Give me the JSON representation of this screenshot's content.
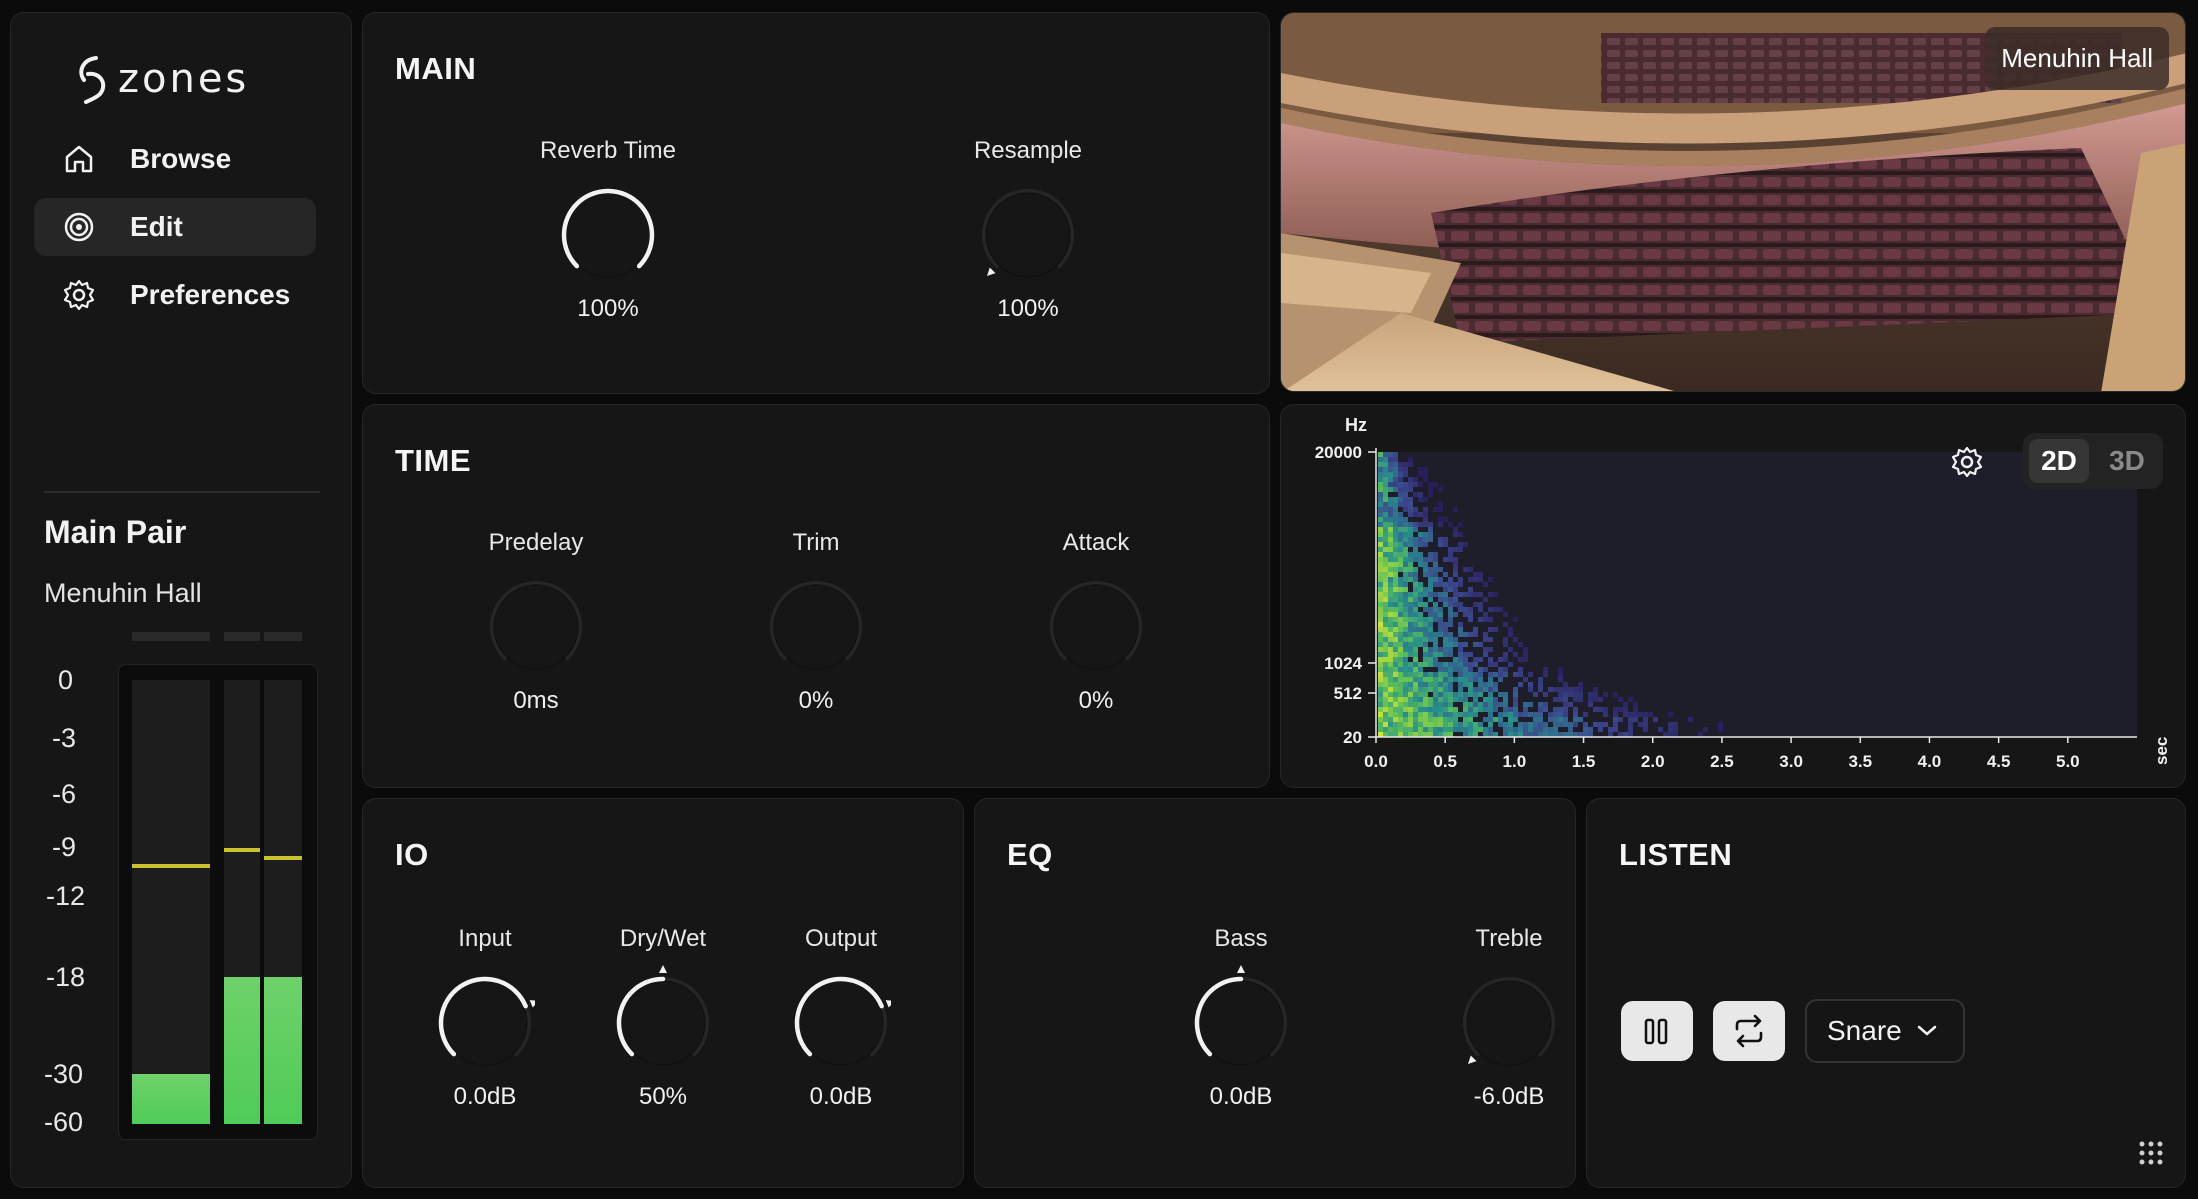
{
  "app": {
    "logo_text": "zones"
  },
  "sidebar": {
    "items": [
      {
        "label": "Browse",
        "icon": "home-icon"
      },
      {
        "label": "Edit",
        "icon": "target-icon"
      },
      {
        "label": "Preferences",
        "icon": "gear-icon"
      }
    ],
    "active_item": "Edit",
    "pair_title": "Main Pair",
    "pair_subtitle": "Menuhin Hall",
    "meter_scale": [
      "0",
      "-3",
      "-6",
      "-9",
      "-12",
      "-18",
      "-30",
      "-60"
    ],
    "meter_channels": [
      {
        "level_db": -30,
        "peak_db": -10
      },
      {
        "level_db": -18,
        "peak_db": -9
      },
      {
        "level_db": -18,
        "peak_db": -9.5
      }
    ],
    "meter_colors": {
      "fill": "#4fcb58",
      "peak": "#c9c22e"
    }
  },
  "main": {
    "title": "MAIN",
    "knobs": [
      {
        "label": "Reverb Time",
        "value": "100%",
        "fraction": 1.0
      },
      {
        "label": "Resample",
        "value": "100%",
        "fraction": 0.0
      }
    ]
  },
  "time": {
    "title": "TIME",
    "knobs": [
      {
        "label": "Predelay",
        "value": "0ms",
        "fraction": 0.0
      },
      {
        "label": "Trim",
        "value": "0%",
        "fraction": 0.0
      },
      {
        "label": "Attack",
        "value": "0%",
        "fraction": 0.0
      }
    ]
  },
  "io": {
    "title": "IO",
    "knobs": [
      {
        "label": "Input",
        "value": "0.0dB",
        "fraction": 0.75
      },
      {
        "label": "Dry/Wet",
        "value": "50%",
        "fraction": 0.5
      },
      {
        "label": "Output",
        "value": "0.0dB",
        "fraction": 0.75
      }
    ]
  },
  "eq": {
    "title": "EQ",
    "knobs": [
      {
        "label": "Bass",
        "value": "0.0dB",
        "fraction": 0.5
      },
      {
        "label": "Treble",
        "value": "-6.0dB",
        "fraction": 0.0
      }
    ]
  },
  "listen": {
    "title": "LISTEN",
    "sample": "Snare",
    "pause_icon": "pause-icon",
    "loop_icon": "loop-icon"
  },
  "hall_photo": {
    "badge": "Menuhin Hall"
  },
  "spectrogram": {
    "y_unit": "Hz",
    "x_unit": "sec",
    "y_ticks": [
      "20000",
      "1024",
      "512",
      "20"
    ],
    "x_ticks": [
      "0.0",
      "0.5",
      "1.0",
      "1.5",
      "2.0",
      "2.5",
      "3.0",
      "3.5",
      "4.0",
      "4.5",
      "5.0"
    ],
    "view_modes": [
      "2D",
      "3D"
    ],
    "active_mode": "2D",
    "decay_end_sec": 2.5
  },
  "colors": {
    "accent": "#f2f2f2",
    "panel_bg": "#161616",
    "spec_bg": "#1e1e2a"
  }
}
